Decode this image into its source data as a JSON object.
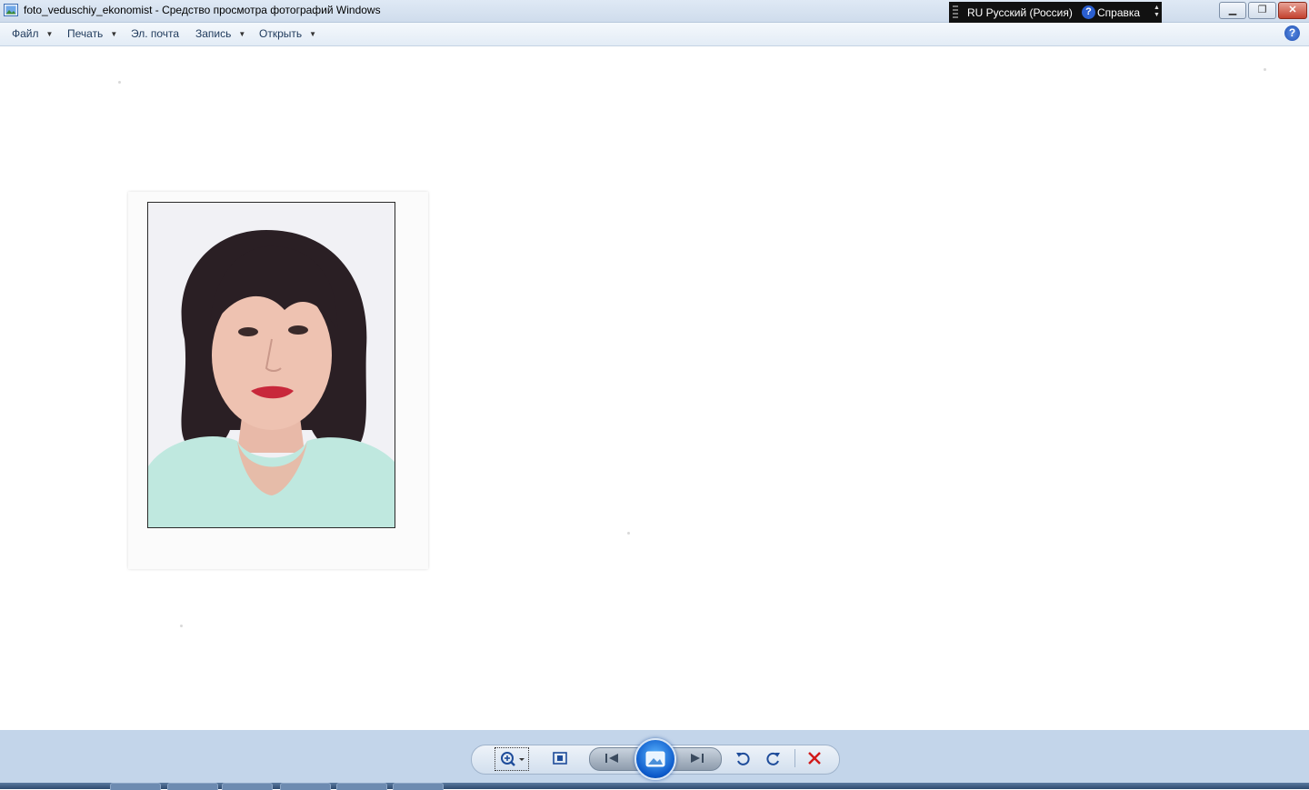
{
  "window": {
    "title": "foto_veduschiy_ekonomist - Средство просмотра фотографий Windows",
    "app_icon": "photo-viewer-icon"
  },
  "language_bar": {
    "language": "RU Русский (Россия)",
    "help_label": "Справка"
  },
  "window_controls": {
    "minimize_icon": "minimize-icon",
    "maximize_icon": "restore-icon",
    "close_icon": "close-icon"
  },
  "menu": {
    "items": [
      {
        "label": "Файл",
        "has_dropdown": true
      },
      {
        "label": "Печать",
        "has_dropdown": true
      },
      {
        "label": "Эл. почта",
        "has_dropdown": false
      },
      {
        "label": "Запись",
        "has_dropdown": true
      },
      {
        "label": "Открыть",
        "has_dropdown": true
      }
    ],
    "help_icon": "help-icon"
  },
  "image": {
    "description_icon": "portrait-photo"
  },
  "controls": {
    "buttons": [
      "zoom-icon",
      "actual-size-icon",
      "previous-icon",
      "slideshow-icon",
      "next-icon",
      "rotate-counterclockwise-icon",
      "rotate-clockwise-icon",
      "delete-icon"
    ]
  },
  "colors": {
    "controls_background": "#c3d5ea",
    "delete_red": "#d11a1a",
    "accent_blue": "#0b58c9"
  }
}
